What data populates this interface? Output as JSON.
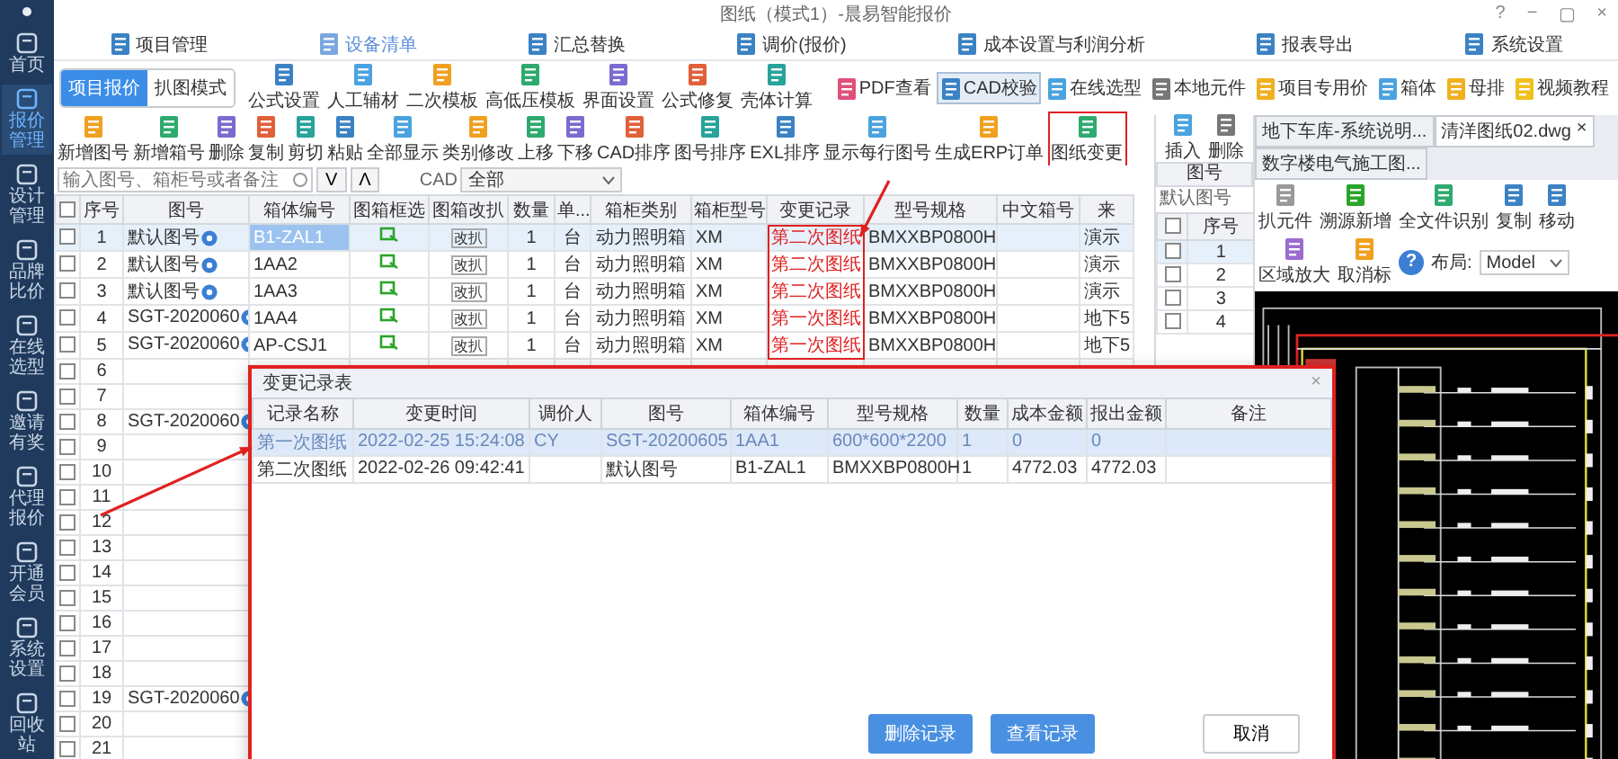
{
  "window": {
    "title": "图纸（模式1）-晨易智能报价",
    "controls": [
      "?",
      "−",
      "▢",
      "×"
    ]
  },
  "sidebar": {
    "items": [
      {
        "label": "首页",
        "selected": false
      },
      {
        "label": "报价管理",
        "selected": true
      },
      {
        "label": "设计管理",
        "selected": false
      },
      {
        "label": "品牌比价",
        "selected": false
      },
      {
        "label": "在线选型",
        "selected": false
      },
      {
        "label": "邀请有奖",
        "selected": false
      },
      {
        "label": "代理报价",
        "selected": false
      },
      {
        "label": "开通会员",
        "selected": false
      },
      {
        "label": "系统设置",
        "selected": false
      },
      {
        "label": "回收站",
        "selected": false
      }
    ]
  },
  "modules": [
    {
      "label": "项目管理",
      "selected": false
    },
    {
      "label": "设备清单",
      "selected": true
    },
    {
      "label": "汇总替换",
      "selected": false
    },
    {
      "label": "调价(报价)",
      "selected": false
    },
    {
      "label": "成本设置与利润分析",
      "selected": false
    },
    {
      "label": "报表导出",
      "selected": false
    },
    {
      "label": "系统设置",
      "selected": false
    }
  ],
  "mode_toggle": [
    {
      "label": "项目报价",
      "selected": true
    },
    {
      "label": "扒图模式",
      "selected": false
    }
  ],
  "toolbar_top": [
    "公式设置",
    "人工辅材",
    "二次模板",
    "高低压模板",
    "界面设置",
    "公式修复",
    "壳体计算"
  ],
  "toolbar_right": [
    {
      "label": "PDF查看",
      "selected": false
    },
    {
      "label": "CAD校验",
      "selected": true
    },
    {
      "label": "在线选型",
      "selected": false
    },
    {
      "label": "本地元件",
      "selected": false
    },
    {
      "label": "项目专用价",
      "selected": false
    },
    {
      "label": "箱体",
      "selected": false
    },
    {
      "label": "母排",
      "selected": false
    },
    {
      "label": "视频教程",
      "selected": false
    }
  ],
  "toolbar_main": [
    {
      "label": "新增图号",
      "highlighted": false
    },
    {
      "label": "新增箱号",
      "highlighted": false
    },
    {
      "label": "删除",
      "highlighted": false
    },
    {
      "label": "复制",
      "highlighted": false
    },
    {
      "label": "剪切",
      "highlighted": false
    },
    {
      "label": "粘贴",
      "highlighted": false
    },
    {
      "label": "全部显示",
      "highlighted": false
    },
    {
      "label": "类别修改",
      "highlighted": false
    },
    {
      "label": "上移",
      "highlighted": false
    },
    {
      "label": "下移",
      "highlighted": false
    },
    {
      "label": "CAD排序",
      "highlighted": false
    },
    {
      "label": "图号排序",
      "highlighted": false
    },
    {
      "label": "EXL排序",
      "highlighted": false
    },
    {
      "label": "显示每行图号",
      "highlighted": false
    },
    {
      "label": "生成ERP订单",
      "highlighted": false
    },
    {
      "label": "图纸变更",
      "highlighted": true
    }
  ],
  "search": {
    "placeholder": "输入图号、箱柜号或者备注",
    "buttons": [
      "V",
      "Λ"
    ],
    "cad_label": "CAD",
    "cad_filter": "全部"
  },
  "table": {
    "all_checked": false,
    "columns": [
      {
        "label": "序号",
        "highlighted": false
      },
      {
        "label": "图号",
        "highlighted": false
      },
      {
        "label": "箱体编号",
        "highlighted": false
      },
      {
        "label": "图箱框选",
        "highlighted": false
      },
      {
        "label": "图箱改扒",
        "highlighted": false
      },
      {
        "label": "数量",
        "highlighted": false
      },
      {
        "label": "单...",
        "highlighted": false
      },
      {
        "label": "箱柜类别",
        "highlighted": false
      },
      {
        "label": "箱柜型号",
        "highlighted": false
      },
      {
        "label": "变更记录",
        "highlighted": true
      },
      {
        "label": "型号规格",
        "highlighted": false
      },
      {
        "label": "中文箱号",
        "highlighted": false
      },
      {
        "label": "来",
        "highlighted": false
      }
    ],
    "rows": [
      {
        "no": "1",
        "checked": false,
        "selected": true,
        "drawing_no": "默认图号",
        "box_no": "B1-ZAL1",
        "frame_icon": true,
        "modify": "改扒",
        "qty": "1",
        "unit": "台",
        "category": "动力照明箱",
        "model": "XM",
        "change": "第二次图纸",
        "spec": "BMXXBP0800H",
        "extra": "演示"
      },
      {
        "no": "2",
        "checked": false,
        "selected": false,
        "drawing_no": "默认图号",
        "box_no": "1AA2",
        "frame_icon": true,
        "modify": "改扒",
        "qty": "1",
        "unit": "台",
        "category": "动力照明箱",
        "model": "XM",
        "change": "第二次图纸",
        "spec": "BMXXBP0800H",
        "extra": "演示"
      },
      {
        "no": "3",
        "checked": false,
        "selected": false,
        "drawing_no": "默认图号",
        "box_no": "1AA3",
        "frame_icon": true,
        "modify": "改扒",
        "qty": "1",
        "unit": "台",
        "category": "动力照明箱",
        "model": "XM",
        "change": "第二次图纸",
        "spec": "BMXXBP0800H",
        "extra": "演示"
      },
      {
        "no": "4",
        "checked": false,
        "selected": false,
        "drawing_no": "SGT-2020060",
        "box_no": "1AA4",
        "frame_icon": true,
        "modify": "改扒",
        "qty": "1",
        "unit": "台",
        "category": "动力照明箱",
        "model": "XM",
        "change": "第一次图纸",
        "spec": "BMXXBP0800H",
        "extra": "地下5"
      },
      {
        "no": "5",
        "checked": false,
        "selected": false,
        "drawing_no": "SGT-2020060",
        "box_no": "AP-CSJ1",
        "frame_icon": true,
        "modify": "改扒",
        "qty": "1",
        "unit": "台",
        "category": "动力照明箱",
        "model": "XM",
        "change": "第一次图纸",
        "spec": "BMXXBP0800H",
        "extra": "地下5"
      },
      {
        "no": "6",
        "checked": false,
        "selected": false
      },
      {
        "no": "7",
        "checked": false,
        "selected": false
      },
      {
        "no": "8",
        "checked": false,
        "selected": false,
        "drawing_no": "SGT-2020060"
      },
      {
        "no": "9",
        "checked": false,
        "selected": false
      },
      {
        "no": "10",
        "checked": false,
        "selected": false
      },
      {
        "no": "11",
        "checked": false,
        "selected": false
      },
      {
        "no": "12",
        "checked": false,
        "selected": false
      },
      {
        "no": "13",
        "checked": false,
        "selected": false
      },
      {
        "no": "14",
        "checked": false,
        "selected": false
      },
      {
        "no": "15",
        "checked": false,
        "selected": false
      },
      {
        "no": "16",
        "checked": false,
        "selected": false
      },
      {
        "no": "17",
        "checked": false,
        "selected": false
      },
      {
        "no": "18",
        "checked": false,
        "selected": false
      },
      {
        "no": "19",
        "checked": false,
        "selected": false,
        "drawing_no": "SGT-2020060"
      },
      {
        "no": "20",
        "checked": false,
        "selected": false
      },
      {
        "no": "21",
        "checked": false,
        "selected": false
      }
    ]
  },
  "mini_panel": {
    "all_checked": false,
    "tools": [
      "插入",
      "删除"
    ],
    "header": "图号",
    "value": "默认图号",
    "column": "序号",
    "rows": [
      {
        "no": "1",
        "checked": false,
        "selected": true
      },
      {
        "no": "2",
        "checked": false,
        "selected": false
      },
      {
        "no": "3",
        "checked": false,
        "selected": false
      },
      {
        "no": "4",
        "checked": false,
        "selected": false
      }
    ]
  },
  "cad": {
    "tabs": [
      {
        "label": "地下车库-系统说明...",
        "selected": false
      },
      {
        "label": "清洋图纸02.dwg",
        "selected": true,
        "close": "×"
      },
      {
        "label": "数字楼电气施工图...",
        "selected": false
      }
    ],
    "tools": [
      "扒元件",
      "溯源新增",
      "全文件识别",
      "复制",
      "移动",
      "区域放大",
      "取消标"
    ],
    "help": "?",
    "layout_label": "布局:",
    "layout_value": "Model"
  },
  "dialog": {
    "title": "变更记录表",
    "close": "×",
    "columns": [
      "记录名称",
      "变更时间",
      "调价人",
      "图号",
      "箱体编号",
      "型号规格",
      "数量",
      "成本金额",
      "报出金额",
      "备注"
    ],
    "rows": [
      {
        "selected": true,
        "cells": [
          "第一次图纸",
          "2022-02-25 15:24:08",
          "CY",
          "SGT-20200605",
          "1AA1",
          "600*600*2200",
          "1",
          "0",
          "0"
        ]
      },
      {
        "selected": false,
        "cells": [
          "第二次图纸",
          "2022-02-26 09:42:41",
          "",
          "默认图号",
          "B1-ZAL1",
          "BMXXBP0800H",
          "1",
          "4772.03",
          "4772.03"
        ]
      }
    ],
    "buttons": [
      {
        "label": "删除记录",
        "kind": "primary"
      },
      {
        "label": "查看记录",
        "kind": "primary"
      },
      {
        "label": "取消",
        "kind": "plain"
      }
    ]
  }
}
